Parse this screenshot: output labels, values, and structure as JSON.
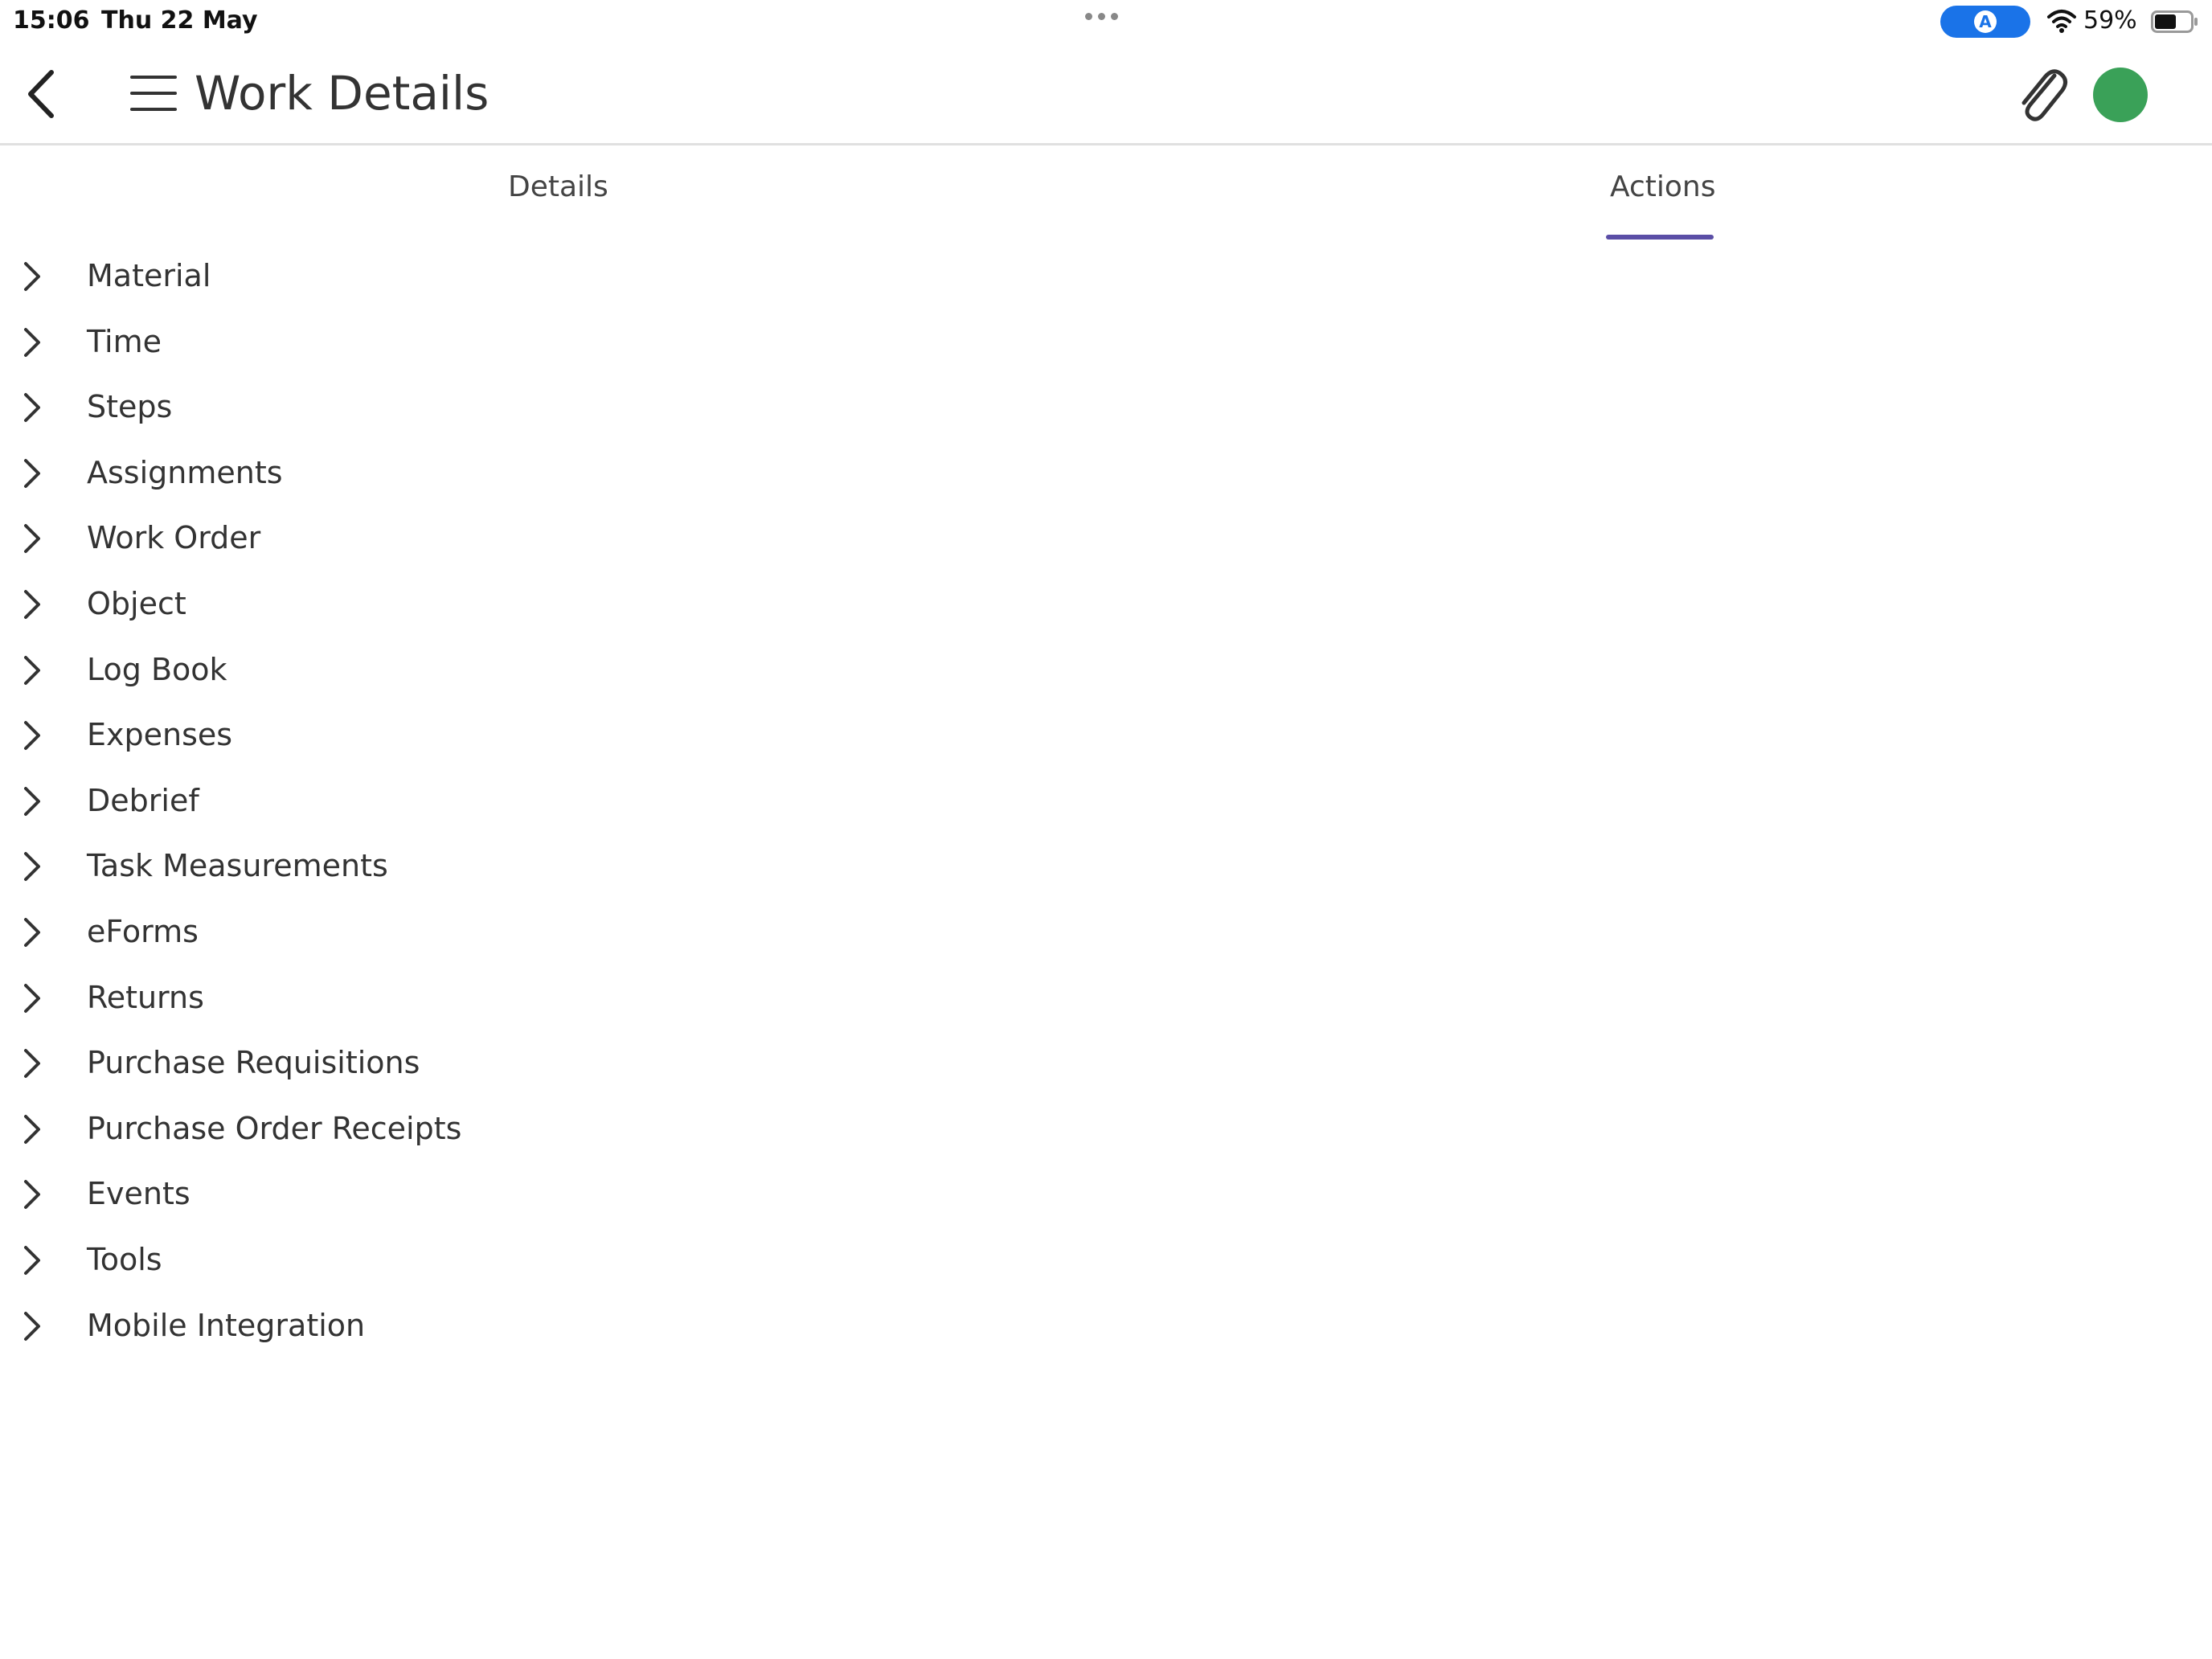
{
  "status_bar": {
    "time": "15:06",
    "date": "Thu 22 May",
    "vpn_label": "A",
    "battery_percent": "59%",
    "battery_level": 0.59,
    "accent_color": "#1a73e8"
  },
  "nav": {
    "back_icon": "chevron-left-icon",
    "menu_icon": "hamburger-menu-icon",
    "title": "Work Details",
    "attach_icon": "paperclip-icon",
    "status_color": "#3aa158"
  },
  "tabs": [
    {
      "label": "Details",
      "active": false
    },
    {
      "label": "Actions",
      "active": true
    }
  ],
  "tab_indicator_color": "#5b4ea6",
  "actions": [
    {
      "label": "Material"
    },
    {
      "label": "Time"
    },
    {
      "label": "Steps"
    },
    {
      "label": "Assignments"
    },
    {
      "label": "Work Order"
    },
    {
      "label": "Object"
    },
    {
      "label": "Log Book"
    },
    {
      "label": "Expenses"
    },
    {
      "label": "Debrief"
    },
    {
      "label": "Task Measurements"
    },
    {
      "label": "eForms"
    },
    {
      "label": "Returns"
    },
    {
      "label": "Purchase Requisitions"
    },
    {
      "label": "Purchase Order Receipts"
    },
    {
      "label": "Events"
    },
    {
      "label": "Tools"
    },
    {
      "label": "Mobile Integration"
    }
  ]
}
